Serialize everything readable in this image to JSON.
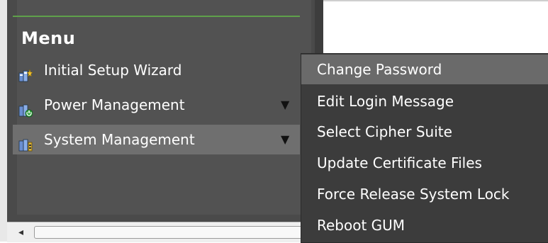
{
  "menu": {
    "title": "Menu",
    "items": [
      {
        "label": "Initial Setup Wizard",
        "icon": "setup-wizard-icon",
        "has_submenu": false,
        "active": false
      },
      {
        "label": "Power Management",
        "icon": "power-management-icon",
        "has_submenu": true,
        "active": false
      },
      {
        "label": "System Management",
        "icon": "system-management-icon",
        "has_submenu": true,
        "active": true
      }
    ],
    "submenu_arrow": "▼"
  },
  "dropdown": {
    "items": [
      {
        "label": "Change Password",
        "highlighted": true
      },
      {
        "label": "Edit Login Message",
        "highlighted": false
      },
      {
        "label": "Select Cipher Suite",
        "highlighted": false
      },
      {
        "label": "Update Certificate Files",
        "highlighted": false
      },
      {
        "label": "Force Release System Lock",
        "highlighted": false
      },
      {
        "label": "Reboot GUM",
        "highlighted": false
      }
    ]
  },
  "scrollbar": {
    "left_arrow": "◂"
  },
  "colors": {
    "accent_line": "#5fa04a",
    "panel_bg": "#525252",
    "dropdown_bg": "#3c3c3c",
    "highlight": "#6a6a6a"
  }
}
